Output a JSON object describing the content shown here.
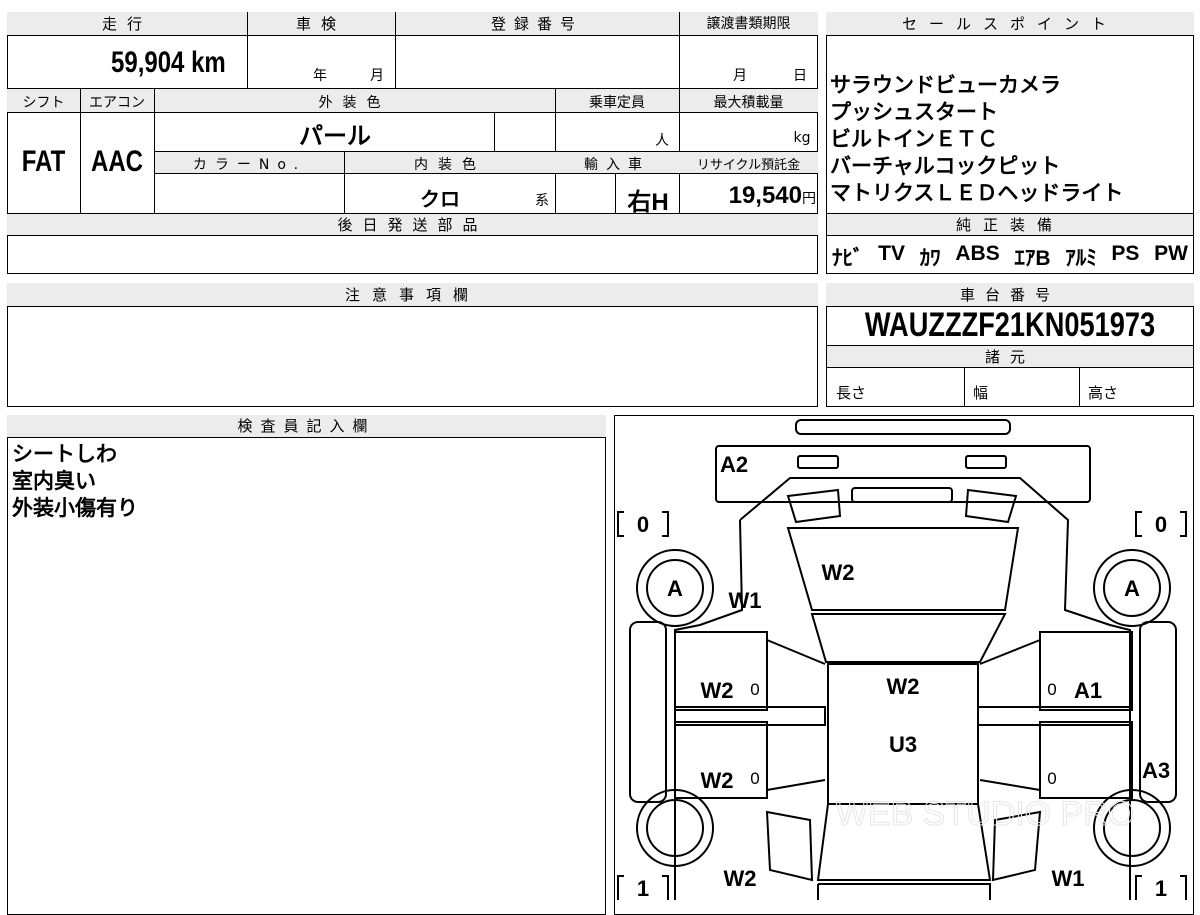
{
  "top_table": {
    "mileage_label": "走行",
    "mileage_value": "59,904",
    "mileage_unit": "km",
    "shaken_label": "車検",
    "year_label": "年",
    "month_label": "月",
    "registration_label": "登録番号",
    "transfer_label": "譲渡書類期限",
    "transfer_month": "月",
    "transfer_day": "日",
    "shift_label": "シフト",
    "shift_value": "FAT",
    "aircon_label": "エアコン",
    "aircon_value": "AAC",
    "exterior_label": "外装色",
    "exterior_value": "パール",
    "capacity_label": "乗車定員",
    "capacity_unit": "人",
    "load_label": "最大積載量",
    "load_unit": "kg",
    "colorno_label": "カラーNo.",
    "interior_label": "内装色",
    "interior_value": "クロ",
    "interior_suffix": "系",
    "import_label": "輸入車",
    "import_value": "右H",
    "recycle_label": "リサイクル預託金",
    "recycle_value": "19,540",
    "recycle_unit": "円",
    "later_parts_label": "後日発送部品"
  },
  "sales_points": {
    "header": "セールスポイント",
    "items": [
      "サラウンドビューカメラ",
      "プッシュスタート",
      "ビルトインＥＴＣ",
      "バーチャルコックピット",
      "マトリクスＬＥＤヘッドライト"
    ]
  },
  "equipment": {
    "header": "純正装備",
    "items": [
      "ﾅﾋﾞ",
      "TV",
      "ｶﾜ",
      "ABS",
      "ｴｱB",
      "ｱﾙﾐ",
      "PS",
      "PW"
    ]
  },
  "notes": {
    "header": "注意事項欄"
  },
  "chassis": {
    "header": "車台番号",
    "value": "WAUZZZF21KN051973",
    "spec_header": "諸元",
    "length_label": "長さ",
    "width_label": "幅",
    "height_label": "高さ"
  },
  "inspector": {
    "header": "検査員記入欄",
    "lines": [
      "シートしわ",
      "室内臭い",
      "外装小傷有り"
    ]
  },
  "diagram": {
    "tire_front_left": "0",
    "tire_front_right": "0",
    "tire_rear_left": "1",
    "tire_rear_right": "1",
    "marks": {
      "front_bumper": "A2",
      "windshield": "W2",
      "left_front_glass": "W1",
      "left_wheel": "A",
      "right_wheel": "A",
      "roof_front": "W2",
      "roof_mid": "U3",
      "left_front_door": "W2",
      "left_front_door_zero": "0",
      "left_rear_door": "W2",
      "left_rear_door_zero": "0",
      "right_front_door": "A1",
      "right_front_door_zero": "0",
      "right_rear_door_zero": "0",
      "right_quarter": "A3",
      "left_rear_glass": "W2",
      "right_rear_glass": "W1"
    },
    "watermark": "WEB STUDIO PRO"
  }
}
